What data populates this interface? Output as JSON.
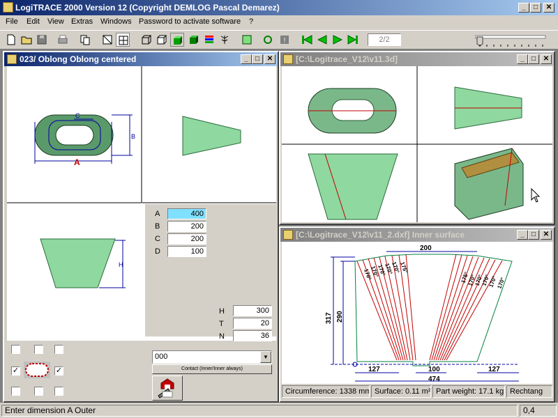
{
  "app": {
    "title": "LogiTRACE 2000  Version 12  (Copyright DEMLOG Pascal Demarez)",
    "win_min": "_",
    "win_max": "□",
    "win_close": "✕"
  },
  "menu": [
    "File",
    "Edit",
    "View",
    "Extras",
    "Windows",
    "Password to activate software",
    "?"
  ],
  "toolbar": {
    "page_indicator": "2/2"
  },
  "window_left": {
    "title": "023/ Oblong Oblong centered",
    "dims": [
      {
        "label": "A",
        "value": "400"
      },
      {
        "label": "B",
        "value": "200"
      },
      {
        "label": "C",
        "value": "200"
      },
      {
        "label": "D",
        "value": "100"
      }
    ],
    "params": [
      {
        "label": "H",
        "value": "300"
      },
      {
        "label": "T",
        "value": "20"
      },
      {
        "label": "N",
        "value": "36"
      }
    ],
    "drawing_labels": {
      "a": "A",
      "b": "B",
      "c": "C",
      "h": "H"
    },
    "combo_value": "000",
    "contact_button": "Contact (Inner/Inner always)"
  },
  "window_3d": {
    "title": "[C:\\Logitrace_V12\\v11.3d]"
  },
  "window_dxf": {
    "title": "[C:\\Logitrace_V12\\v11_2.dxf]  Inner surface",
    "dims": {
      "top": "200",
      "left_outer": "317",
      "left_inner": "290",
      "bottom_left": "127",
      "bottom_mid": "100",
      "bottom_right": "127",
      "total": "474"
    },
    "angle_labels": [
      "170°",
      "170°",
      "170°",
      "170°",
      "170°",
      "175°",
      "175°",
      "170°",
      "170°",
      "170°",
      "170°",
      "170°"
    ],
    "status": {
      "circumference": "Circumference: 1338 mm",
      "surface": "Surface: 0.11 m²",
      "weight": "Part weight: 17.1 kg",
      "shape": "Rechtang"
    }
  },
  "statusbar": {
    "message": "Enter dimension A Outer",
    "version": "0,4"
  },
  "colors": {
    "titlebar": "#0a246a",
    "shape_fill": "#9fe8b8",
    "dim_blue": "#0000a0",
    "dim_red": "#c00000"
  }
}
